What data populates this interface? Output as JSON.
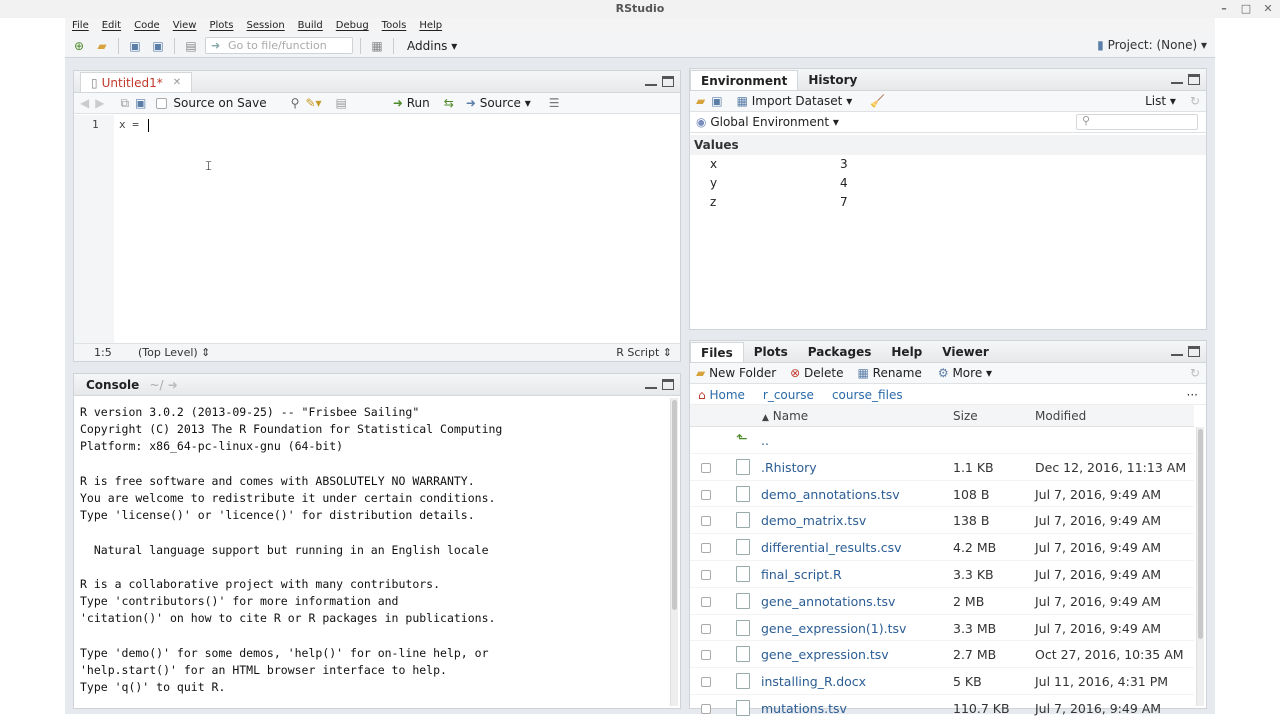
{
  "window": {
    "title": "RStudio"
  },
  "menu": [
    "File",
    "Edit",
    "Code",
    "View",
    "Plots",
    "Session",
    "Build",
    "Debug",
    "Tools",
    "Help"
  ],
  "toolbar": {
    "goto_placeholder": "Go to file/function",
    "addins": "Addins",
    "project": "Project: (None)"
  },
  "editor": {
    "tab": "Untitled1*",
    "source_on_save": "Source on Save",
    "run": "Run",
    "source": "Source",
    "line_number": "1",
    "code": "x = ",
    "status_pos": "1:5",
    "status_level": "(Top Level)",
    "status_type": "R Script"
  },
  "console": {
    "title": "Console",
    "path": "~/",
    "lines": [
      "R version 3.0.2 (2013-09-25) -- \"Frisbee Sailing\"",
      "Copyright (C) 2013 The R Foundation for Statistical Computing",
      "Platform: x86_64-pc-linux-gnu (64-bit)",
      "",
      "R is free software and comes with ABSOLUTELY NO WARRANTY.",
      "You are welcome to redistribute it under certain conditions.",
      "Type 'license()' or 'licence()' for distribution details.",
      "",
      "  Natural language support but running in an English locale",
      "",
      "R is a collaborative project with many contributors.",
      "Type 'contributors()' for more information and",
      "'citation()' on how to cite R or R packages in publications.",
      "",
      "Type 'demo()' for some demos, 'help()' for on-line help, or",
      "'help.start()' for an HTML browser interface to help.",
      "Type 'q()' to quit R."
    ]
  },
  "env": {
    "tabs": [
      "Environment",
      "History"
    ],
    "import": "Import Dataset",
    "list": "List",
    "global": "Global Environment",
    "values_header": "Values",
    "vars": [
      {
        "name": "x",
        "value": "3"
      },
      {
        "name": "y",
        "value": "4"
      },
      {
        "name": "z",
        "value": "7"
      }
    ]
  },
  "files": {
    "tabs": [
      "Files",
      "Plots",
      "Packages",
      "Help",
      "Viewer"
    ],
    "new_folder": "New Folder",
    "delete": "Delete",
    "rename": "Rename",
    "more": "More",
    "crumbs": [
      "Home",
      "r_course",
      "course_files"
    ],
    "col_name": "Name",
    "col_size": "Size",
    "col_modified": "Modified",
    "parent": "..",
    "rows": [
      {
        "name": ".Rhistory",
        "size": "1.1 KB",
        "modified": "Dec 12, 2016, 11:13 AM"
      },
      {
        "name": "demo_annotations.tsv",
        "size": "108 B",
        "modified": "Jul 7, 2016, 9:49 AM"
      },
      {
        "name": "demo_matrix.tsv",
        "size": "138 B",
        "modified": "Jul 7, 2016, 9:49 AM"
      },
      {
        "name": "differential_results.csv",
        "size": "4.2 MB",
        "modified": "Jul 7, 2016, 9:49 AM"
      },
      {
        "name": "final_script.R",
        "size": "3.3 KB",
        "modified": "Jul 7, 2016, 9:49 AM"
      },
      {
        "name": "gene_annotations.tsv",
        "size": "2 MB",
        "modified": "Jul 7, 2016, 9:49 AM"
      },
      {
        "name": "gene_expression(1).tsv",
        "size": "3.3 MB",
        "modified": "Jul 7, 2016, 9:49 AM"
      },
      {
        "name": "gene_expression.tsv",
        "size": "2.7 MB",
        "modified": "Oct 27, 2016, 10:35 AM"
      },
      {
        "name": "installing_R.docx",
        "size": "5 KB",
        "modified": "Jul 11, 2016, 4:31 PM"
      },
      {
        "name": "mutations.tsv",
        "size": "110.7 KB",
        "modified": "Jul 7, 2016, 9:49 AM"
      }
    ]
  }
}
